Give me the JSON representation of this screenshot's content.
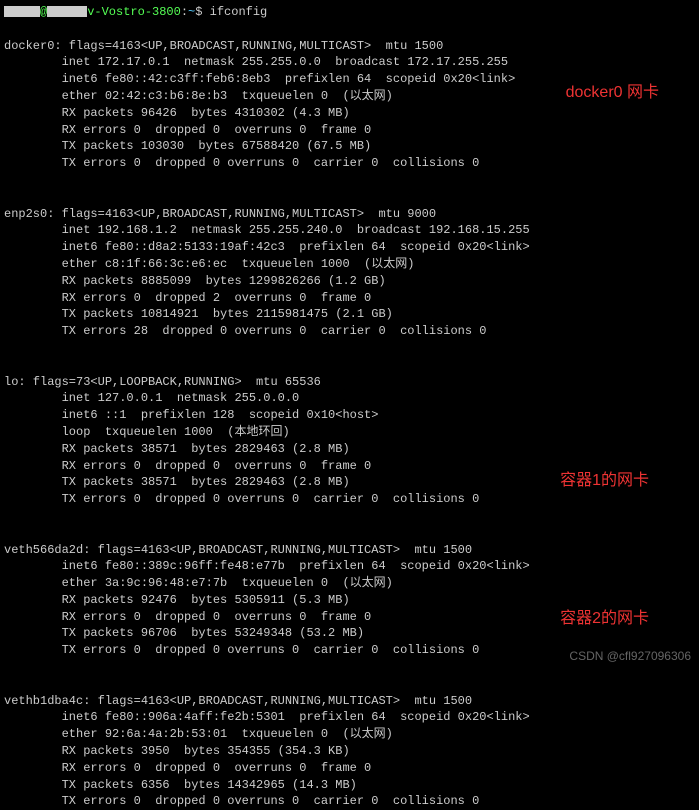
{
  "prompt": {
    "hostname_mid": "v-Vostro-3800",
    "path": "~",
    "command": "ifconfig"
  },
  "interfaces": {
    "docker0": {
      "header": "docker0: flags=4163<UP,BROADCAST,RUNNING,MULTICAST>  mtu 1500",
      "l1": "        inet 172.17.0.1  netmask 255.255.0.0  broadcast 172.17.255.255",
      "l2": "        inet6 fe80::42:c3ff:feb6:8eb3  prefixlen 64  scopeid 0x20<link>",
      "l3": "        ether 02:42:c3:b6:8e:b3  txqueuelen 0  (以太网)",
      "l4": "        RX packets 96426  bytes 4310302 (4.3 MB)",
      "l5": "        RX errors 0  dropped 0  overruns 0  frame 0",
      "l6": "        TX packets 103030  bytes 67588420 (67.5 MB)",
      "l7": "        TX errors 0  dropped 0 overruns 0  carrier 0  collisions 0"
    },
    "enp2s0": {
      "header": "enp2s0: flags=4163<UP,BROADCAST,RUNNING,MULTICAST>  mtu 9000",
      "l1": "        inet 192.168.1.2  netmask 255.255.240.0  broadcast 192.168.15.255",
      "l2": "        inet6 fe80::d8a2:5133:19af:42c3  prefixlen 64  scopeid 0x20<link>",
      "l3": "        ether c8:1f:66:3c:e6:ec  txqueuelen 1000  (以太网)",
      "l4": "        RX packets 8885099  bytes 1299826266 (1.2 GB)",
      "l5": "        RX errors 0  dropped 2  overruns 0  frame 0",
      "l6": "        TX packets 10814921  bytes 2115981475 (2.1 GB)",
      "l7": "        TX errors 28  dropped 0 overruns 0  carrier 0  collisions 0"
    },
    "lo": {
      "header": "lo: flags=73<UP,LOOPBACK,RUNNING>  mtu 65536",
      "l1": "        inet 127.0.0.1  netmask 255.0.0.0",
      "l2": "        inet6 ::1  prefixlen 128  scopeid 0x10<host>",
      "l3": "        loop  txqueuelen 1000  (本地环回)",
      "l4": "        RX packets 38571  bytes 2829463 (2.8 MB)",
      "l5": "        RX errors 0  dropped 0  overruns 0  frame 0",
      "l6": "        TX packets 38571  bytes 2829463 (2.8 MB)",
      "l7": "        TX errors 0  dropped 0 overruns 0  carrier 0  collisions 0"
    },
    "veth1": {
      "header": "veth566da2d: flags=4163<UP,BROADCAST,RUNNING,MULTICAST>  mtu 1500",
      "l1": "        inet6 fe80::389c:96ff:fe48:e77b  prefixlen 64  scopeid 0x20<link>",
      "l2": "        ether 3a:9c:96:48:e7:7b  txqueuelen 0  (以太网)",
      "l3": "        RX packets 92476  bytes 5305911 (5.3 MB)",
      "l4": "        RX errors 0  dropped 0  overruns 0  frame 0",
      "l5": "        TX packets 96706  bytes 53249348 (53.2 MB)",
      "l6": "        TX errors 0  dropped 0 overruns 0  carrier 0  collisions 0"
    },
    "veth2": {
      "header": "vethb1dba4c: flags=4163<UP,BROADCAST,RUNNING,MULTICAST>  mtu 1500",
      "l1": "        inet6 fe80::906a:4aff:fe2b:5301  prefixlen 64  scopeid 0x20<link>",
      "l2": "        ether 92:6a:4a:2b:53:01  txqueuelen 0  (以太网)",
      "l3": "        RX packets 3950  bytes 354355 (354.3 KB)",
      "l4": "        RX errors 0  dropped 0  overruns 0  frame 0",
      "l5": "        TX packets 6356  bytes 14342965 (14.3 MB)",
      "l6": "        TX errors 0  dropped 0 overruns 0  carrier 0  collisions 0"
    }
  },
  "annotations": {
    "docker0": "docker0 网卡",
    "container1": "容器1的网卡",
    "container2": "容器2的网卡"
  },
  "watermark": "CSDN @cfl927096306"
}
